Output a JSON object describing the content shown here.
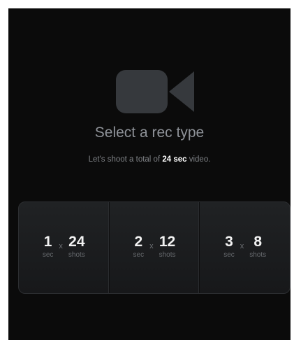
{
  "header": {
    "icon": "video-camera-icon",
    "title": "Select a rec type"
  },
  "subtitle": {
    "prefix": "Let's shoot a total of ",
    "total": "24 sec",
    "suffix": " video."
  },
  "options": [
    {
      "seconds": "1",
      "seconds_unit": "sec",
      "times": "x",
      "shots": "24",
      "shots_unit": "shots"
    },
    {
      "seconds": "2",
      "seconds_unit": "sec",
      "times": "x",
      "shots": "12",
      "shots_unit": "shots"
    },
    {
      "seconds": "3",
      "seconds_unit": "sec",
      "times": "x",
      "shots": "8",
      "shots_unit": "shots"
    }
  ],
  "colors": {
    "background": "#0b0b0b",
    "icon": "#36393d",
    "accent_text": "#ffffff"
  }
}
